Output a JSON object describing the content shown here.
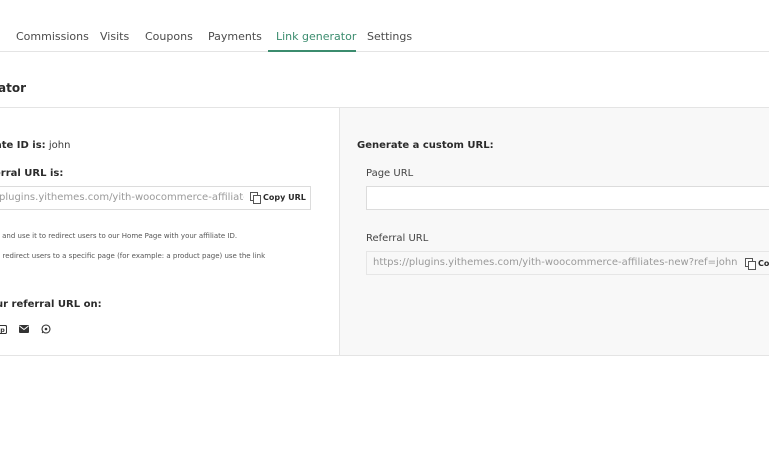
{
  "tabs": [
    {
      "label": "Commissions"
    },
    {
      "label": "Visits"
    },
    {
      "label": "Coupons"
    },
    {
      "label": "Payments"
    },
    {
      "label": "Link generator"
    },
    {
      "label": "Settings"
    }
  ],
  "active_tab": "Link generator",
  "section": {
    "heading": "ator"
  },
  "left": {
    "id_label": "ate ID is:",
    "id_value": "john",
    "ref_label": "erral URL is:",
    "ref_url": "plugins.yithemes.com/yith-woocommerce-affiliates",
    "copy_label": "Copy URL",
    "help_line1": "L and use it to redirect users to our Home Page with your affiliate ID.",
    "help_line2": "o redirect users to a specific page (for example: a product page) use the link",
    "share_label": "ur referral URL on:",
    "share_icons": [
      "pinterest-icon",
      "email-icon",
      "whatsapp-icon"
    ]
  },
  "right": {
    "title": "Generate a custom URL:",
    "page_url_label": "Page URL",
    "page_url_value": "",
    "page_url_placeholder": "",
    "referral_label": "Referral URL",
    "referral_url": "https://plugins.yithemes.com/yith-woocommerce-affiliates-new?ref=john",
    "copy_label": "Cop"
  },
  "colors": {
    "accent": "#3b8c6e",
    "border": "#e4e4e4",
    "panel_bg": "#f8f8f8"
  }
}
